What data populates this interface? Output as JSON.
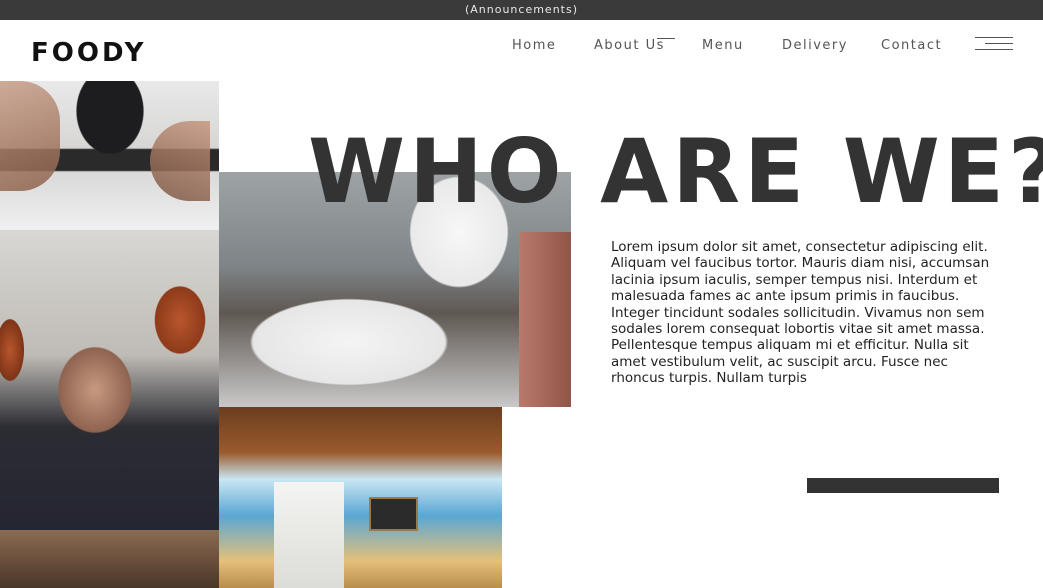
{
  "announcement": "(Announcements)",
  "header": {
    "logo": "FOODY",
    "nav": {
      "home": "Home",
      "about": "About Us",
      "menu": "Menu",
      "delivery": "Delivery",
      "contact": "Contact"
    },
    "menu_icon": "hamburger-icon"
  },
  "photos": {
    "chef_hands": "chef-plating-photo",
    "chef_lamps": "chef-under-heat-lamps-photo",
    "plates": "chef-plates-photo",
    "coffee": "cafe-counter-photo"
  },
  "hero": {
    "title": "WHO ARE WE?",
    "body": "Lorem ipsum dolor sit amet, consectetur adipiscing elit. Aliquam vel faucibus tortor. Mauris diam nisi, accumsan lacinia ipsum iaculis, semper tempus nisi. Interdum et malesuada fames ac ante ipsum primis in faucibus. Integer tincidunt sodales sollicitudin. Vivamus non sem sodales lorem consequat lobortis vitae sit amet massa. Pellentesque tempus aliquam mi et efficitur. Nulla sit amet vestibulum velit, ac suscipit arcu. Fusce nec rhoncus turpis. Nullam turpis"
  },
  "colors": {
    "announcement_bg": "#3a3a3a",
    "title": "#333333",
    "accent_bar": "#333333"
  }
}
